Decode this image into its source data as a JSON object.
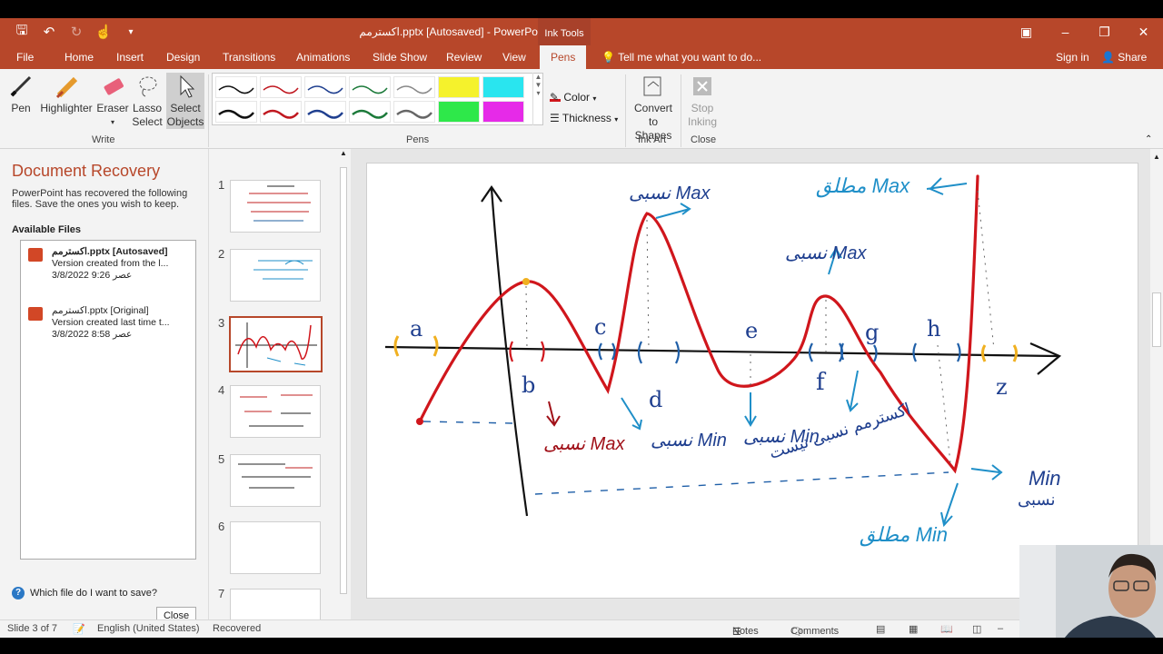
{
  "window": {
    "title": "اکسترمم.pptx [Autosaved] - PowerPoint",
    "context_tab": "Ink Tools"
  },
  "tabs": [
    "File",
    "Home",
    "Insert",
    "Design",
    "Transitions",
    "Animations",
    "Slide Show",
    "Review",
    "View",
    "Pens"
  ],
  "tell_me": "Tell me what you want to do...",
  "account": {
    "sign_in": "Sign in",
    "share": "Share"
  },
  "ribbon": {
    "write": {
      "pen": "Pen",
      "highlighter": "Highlighter",
      "eraser": "Eraser",
      "lasso1": "Lasso",
      "lasso2": "Select",
      "select1": "Select",
      "select2": "Objects",
      "group": "Write"
    },
    "pens": {
      "color": "Color",
      "thickness": "Thickness",
      "group": "Pens"
    },
    "ink_art": {
      "convert1": "Convert",
      "convert2": "to Shapes",
      "group": "Ink Art"
    },
    "close": {
      "stop1": "Stop",
      "stop2": "Inking",
      "group": "Close"
    }
  },
  "recovery": {
    "title": "Document Recovery",
    "description": "PowerPoint has recovered the following files.  Save the ones you wish to keep.",
    "available": "Available Files",
    "files": [
      {
        "name": "اکسترمم.pptx  [Autosaved]",
        "note": "Version created from the l...",
        "date": "3/8/2022 9:26 عصر"
      },
      {
        "name": "اکسترمم.pptx  [Original]",
        "note": "Version created last time t...",
        "date": "3/8/2022 8:58 عصر"
      }
    ],
    "help": "Which file do I want to save?",
    "close": "Close"
  },
  "thumbnails": [
    "1",
    "2",
    "3",
    "4",
    "5",
    "6",
    "7"
  ],
  "slide_ink": {
    "points": [
      "a",
      "b",
      "c",
      "d",
      "e",
      "f",
      "g",
      "h",
      "z"
    ],
    "rel_max": "نسبی Max",
    "rel_min": "نسبی Min",
    "abs_max": "مطلق Max",
    "abs_min": "مطلق Min",
    "min_label": "Min",
    "min_rel_fa": "نسبی",
    "extremum_fa": "اکسترمم نسبی نیست"
  },
  "status": {
    "slide": "Slide 3 of 7",
    "language": "English (United States)",
    "recovered": "Recovered",
    "notes": "Notes",
    "comments": "Comments"
  },
  "colors": {
    "accent": "#b7472a",
    "ink_red": "#d0161c",
    "ink_blue": "#1f8fc8",
    "ink_black": "#111111"
  }
}
